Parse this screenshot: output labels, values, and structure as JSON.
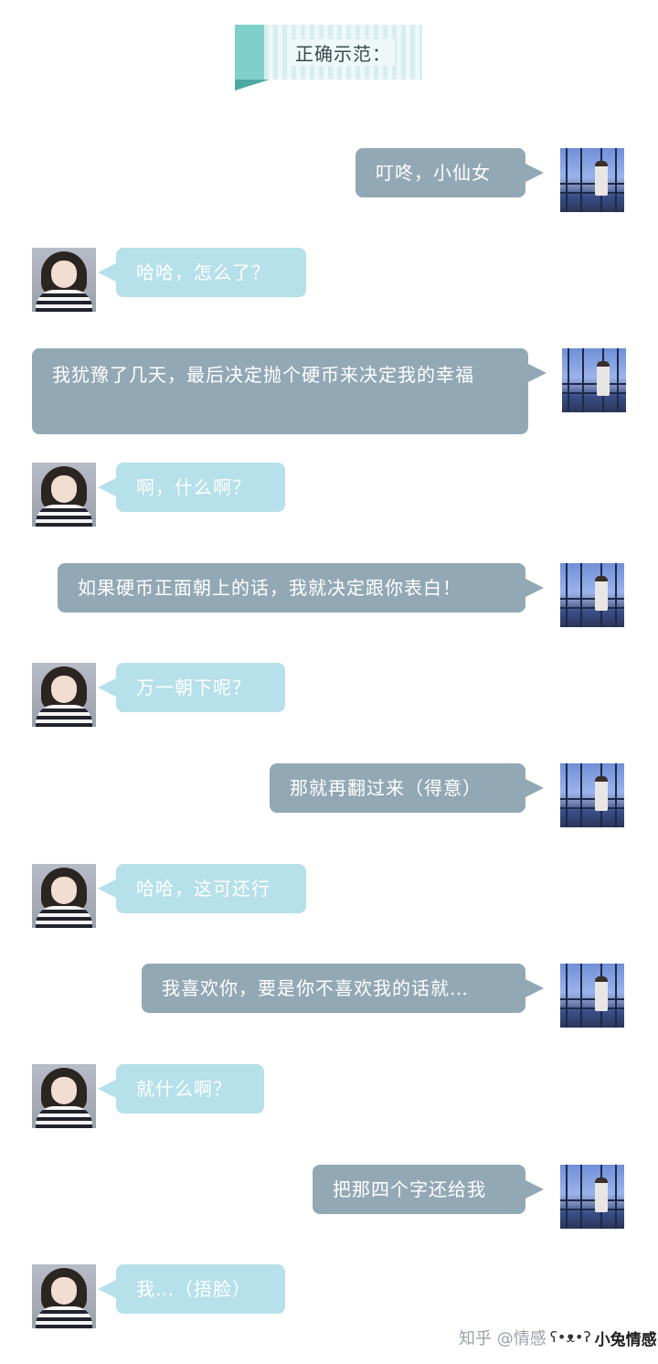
{
  "banner": {
    "title": "正确示范："
  },
  "messages": [
    {
      "from": "him",
      "text": "叮咚，小仙女"
    },
    {
      "from": "her",
      "text": "哈哈，怎么了？"
    },
    {
      "from": "him",
      "text": "我犹豫了几天，最后决定抛个硬币来决定我的幸福"
    },
    {
      "from": "her",
      "text": "啊，什么啊？"
    },
    {
      "from": "him",
      "text": "如果硬币正面朝上的话，我就决定跟你表白！"
    },
    {
      "from": "her",
      "text": "万一朝下呢？"
    },
    {
      "from": "him",
      "text": "那就再翻过来（得意）"
    },
    {
      "from": "her",
      "text": "哈哈，这可还行"
    },
    {
      "from": "him",
      "text": "我喜欢你，要是你不喜欢我的话就…"
    },
    {
      "from": "her",
      "text": "就什么啊？"
    },
    {
      "from": "him",
      "text": "把那四个字还给我"
    },
    {
      "from": "her",
      "text": "我…（捂脸）"
    }
  ],
  "watermark": {
    "text": "知乎 @情感",
    "icon": "rabbit-icon",
    "logo": "小兔情感"
  },
  "colors": {
    "outgoing_bubble": "#93a8b5",
    "incoming_bubble": "#b6e0ea",
    "banner_accent": "#7fd0c8"
  }
}
